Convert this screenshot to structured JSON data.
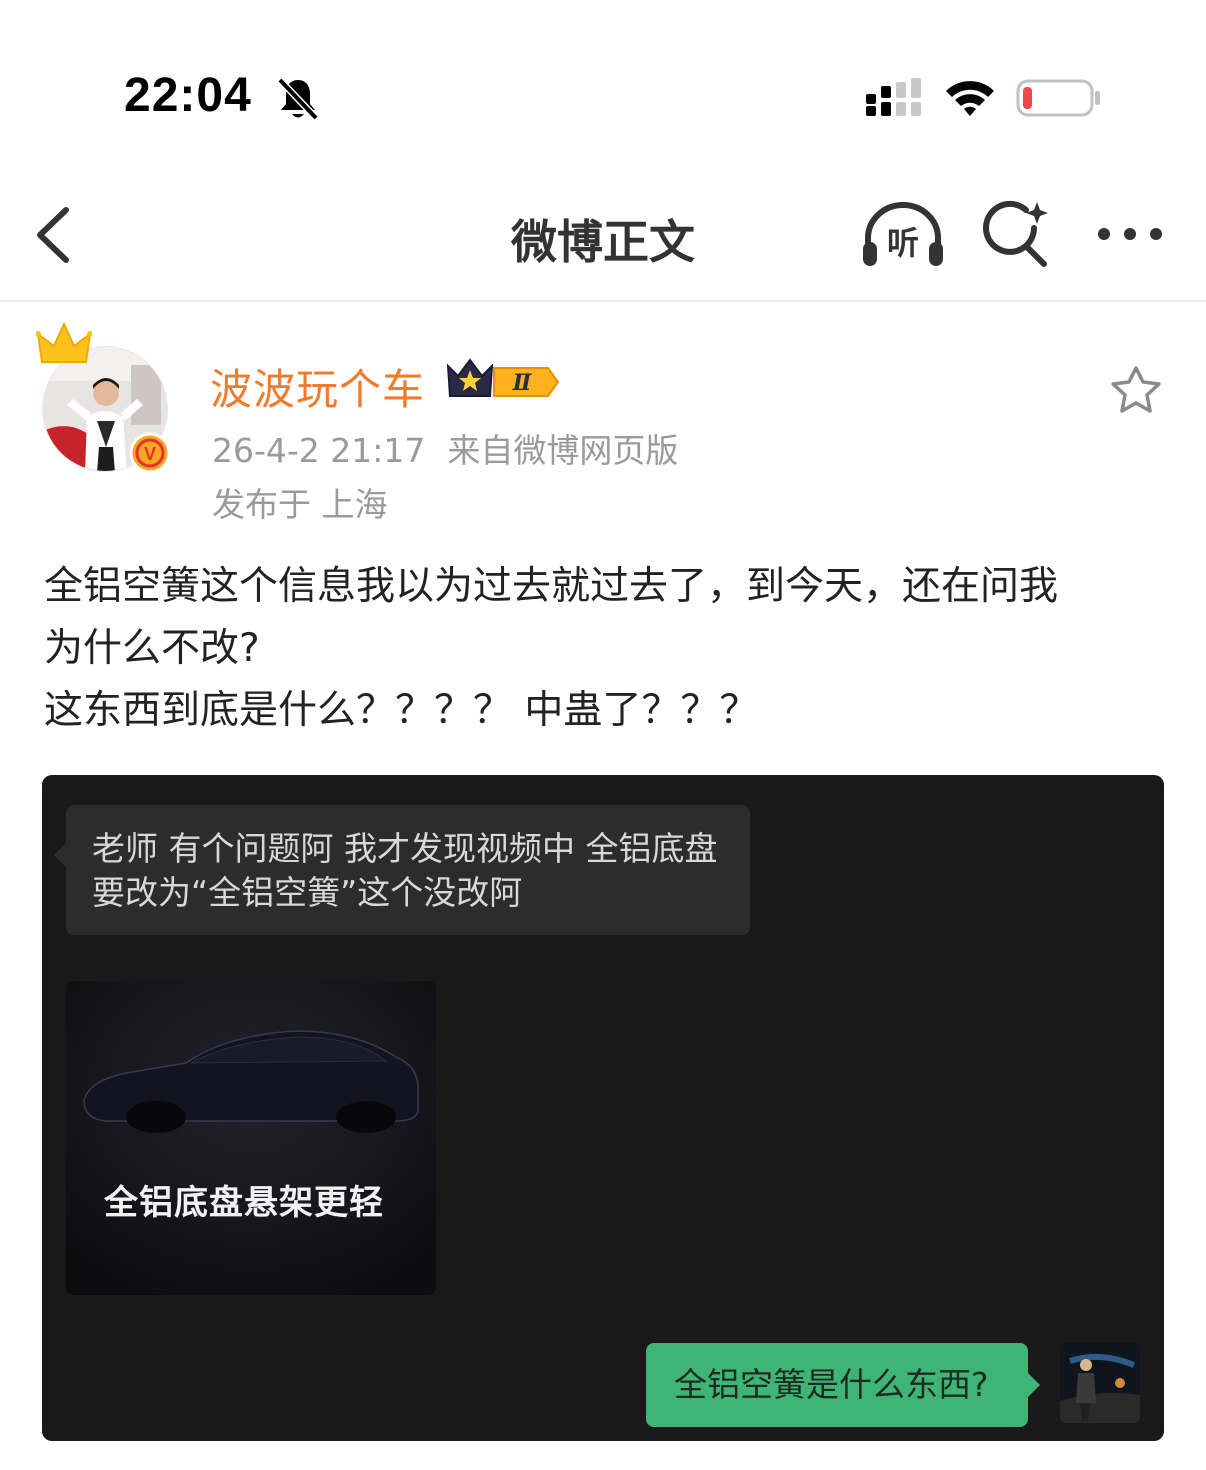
{
  "status_bar": {
    "time": "22:04",
    "battery_level": 0.1,
    "battery_color": "#f04848"
  },
  "nav": {
    "title": "微博正文",
    "listen_label": "听"
  },
  "post": {
    "author": {
      "name": "波波玩个车",
      "name_color": "#f07b2a",
      "vip_level": "Ⅱ",
      "verified_badge": "V"
    },
    "timestamp": "26-4-2 21:17",
    "source": "来自微博网页版",
    "location": "发布于 上海",
    "text_lines": [
      "全铝空簧这个信息我以为过去就过去了，到今天，还在问我",
      "为什么不改?",
      "这东西到底是什么？？？？ 中蛊了？？？"
    ],
    "image": {
      "incoming_message_lines": [
        "老师 有个问题阿 我才发现视频中  全铝底盘",
        "要改为“全铝空簧”这个没改阿"
      ],
      "video_caption": "全铝底盘悬架更轻",
      "outgoing_message": "全铝空簧是什么东西?",
      "outgoing_bubble_color": "#3eb575"
    }
  }
}
